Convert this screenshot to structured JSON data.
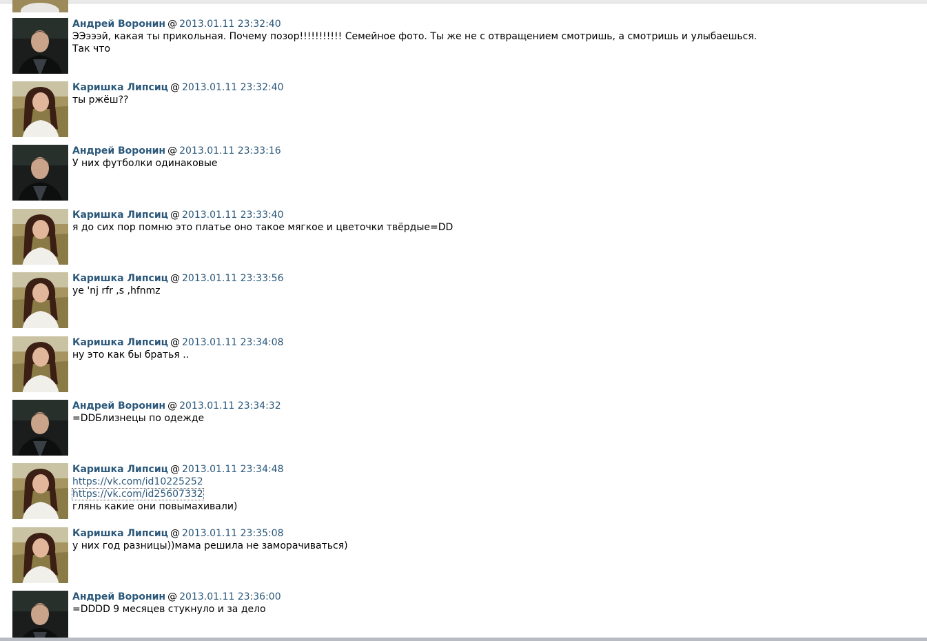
{
  "participants": {
    "andrey": "Андрей Воронин",
    "karishka": "Каришка Липсиц"
  },
  "separator": "@",
  "messages": [
    {
      "author": "Андрей Воронин",
      "avatar": "male-avatar",
      "timestamp": "2013.01.11 23:32:40",
      "lines": [
        "ЭЭэээй, какая ты прикольная. Почему позор!!!!!!!!!!! Семейное фото. Ты же не с отвращением смотришь, а смотришь и улыбаешься.",
        "Так что"
      ]
    },
    {
      "author": "Каришка Липсиц",
      "avatar": "female-avatar",
      "timestamp": "2013.01.11 23:32:40",
      "lines": [
        "ты ржёш??"
      ]
    },
    {
      "author": "Андрей Воронин",
      "avatar": "male-avatar",
      "timestamp": "2013.01.11 23:33:16",
      "lines": [
        "У них футболки одинаковые"
      ]
    },
    {
      "author": "Каришка Липсиц",
      "avatar": "female-avatar",
      "timestamp": "2013.01.11 23:33:40",
      "lines": [
        "я до сих пор помню это платье оно такое мягкое и цветочки твёрдые=DD"
      ]
    },
    {
      "author": "Каришка Липсиц",
      "avatar": "female-avatar",
      "timestamp": "2013.01.11 23:33:56",
      "lines": [
        "ye 'nj rfr ,s ,hfnmz"
      ]
    },
    {
      "author": "Каришка Липсиц",
      "avatar": "female-avatar",
      "timestamp": "2013.01.11 23:34:08",
      "lines": [
        "ну это как бы братья .."
      ]
    },
    {
      "author": "Андрей Воронин",
      "avatar": "male-avatar",
      "timestamp": "2013.01.11 23:34:32",
      "lines": [
        "=DDБлизнецы по одежде"
      ]
    },
    {
      "author": "Каришка Липсиц",
      "avatar": "female-avatar",
      "timestamp": "2013.01.11 23:34:48",
      "links": [
        "https://vk.com/id10225252",
        "https://vk.com/id25607332"
      ],
      "lines": [
        "глянь какие они повымахивали)"
      ]
    },
    {
      "author": "Каришка Липсиц",
      "avatar": "female-avatar",
      "timestamp": "2013.01.11 23:35:08",
      "lines": [
        "у них год разницы))мама решила не заморачиваться)"
      ]
    },
    {
      "author": "Андрей Воронин",
      "avatar": "male-avatar",
      "timestamp": "2013.01.11 23:36:00",
      "lines": [
        "=DDDD 9 месяцев стукнуло и за дело"
      ]
    }
  ],
  "colors": {
    "author": "#2b587a",
    "timestamp": "#2b587a",
    "link": "#2b587a",
    "text": "#000000",
    "background": "#ffffff"
  }
}
